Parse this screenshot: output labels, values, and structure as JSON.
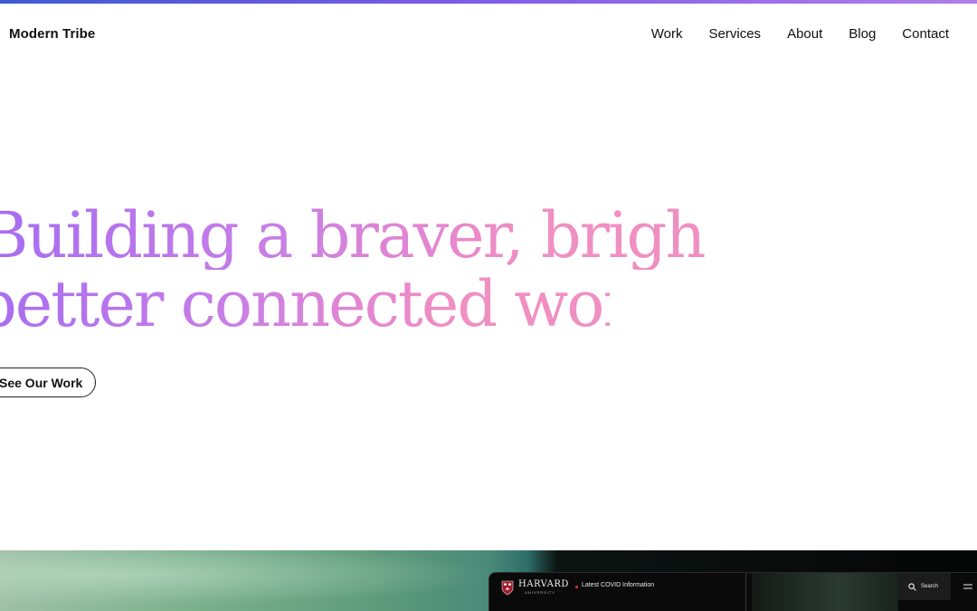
{
  "header": {
    "logo": "Modern Tribe",
    "nav": [
      "Work",
      "Services",
      "About",
      "Blog",
      "Contact"
    ]
  },
  "hero": {
    "line1": "Building a braver, brighter,",
    "line2": "better connected world",
    "cta_label": "See Our Work"
  },
  "showcase": {
    "site_name": "HARVARD",
    "site_sub": "UNIVERSITY",
    "alert_link": "Latest COVID Information",
    "search_label": "Search"
  },
  "colors": {
    "accent_start": "#a66cf2",
    "accent_end": "#f08fc2"
  }
}
